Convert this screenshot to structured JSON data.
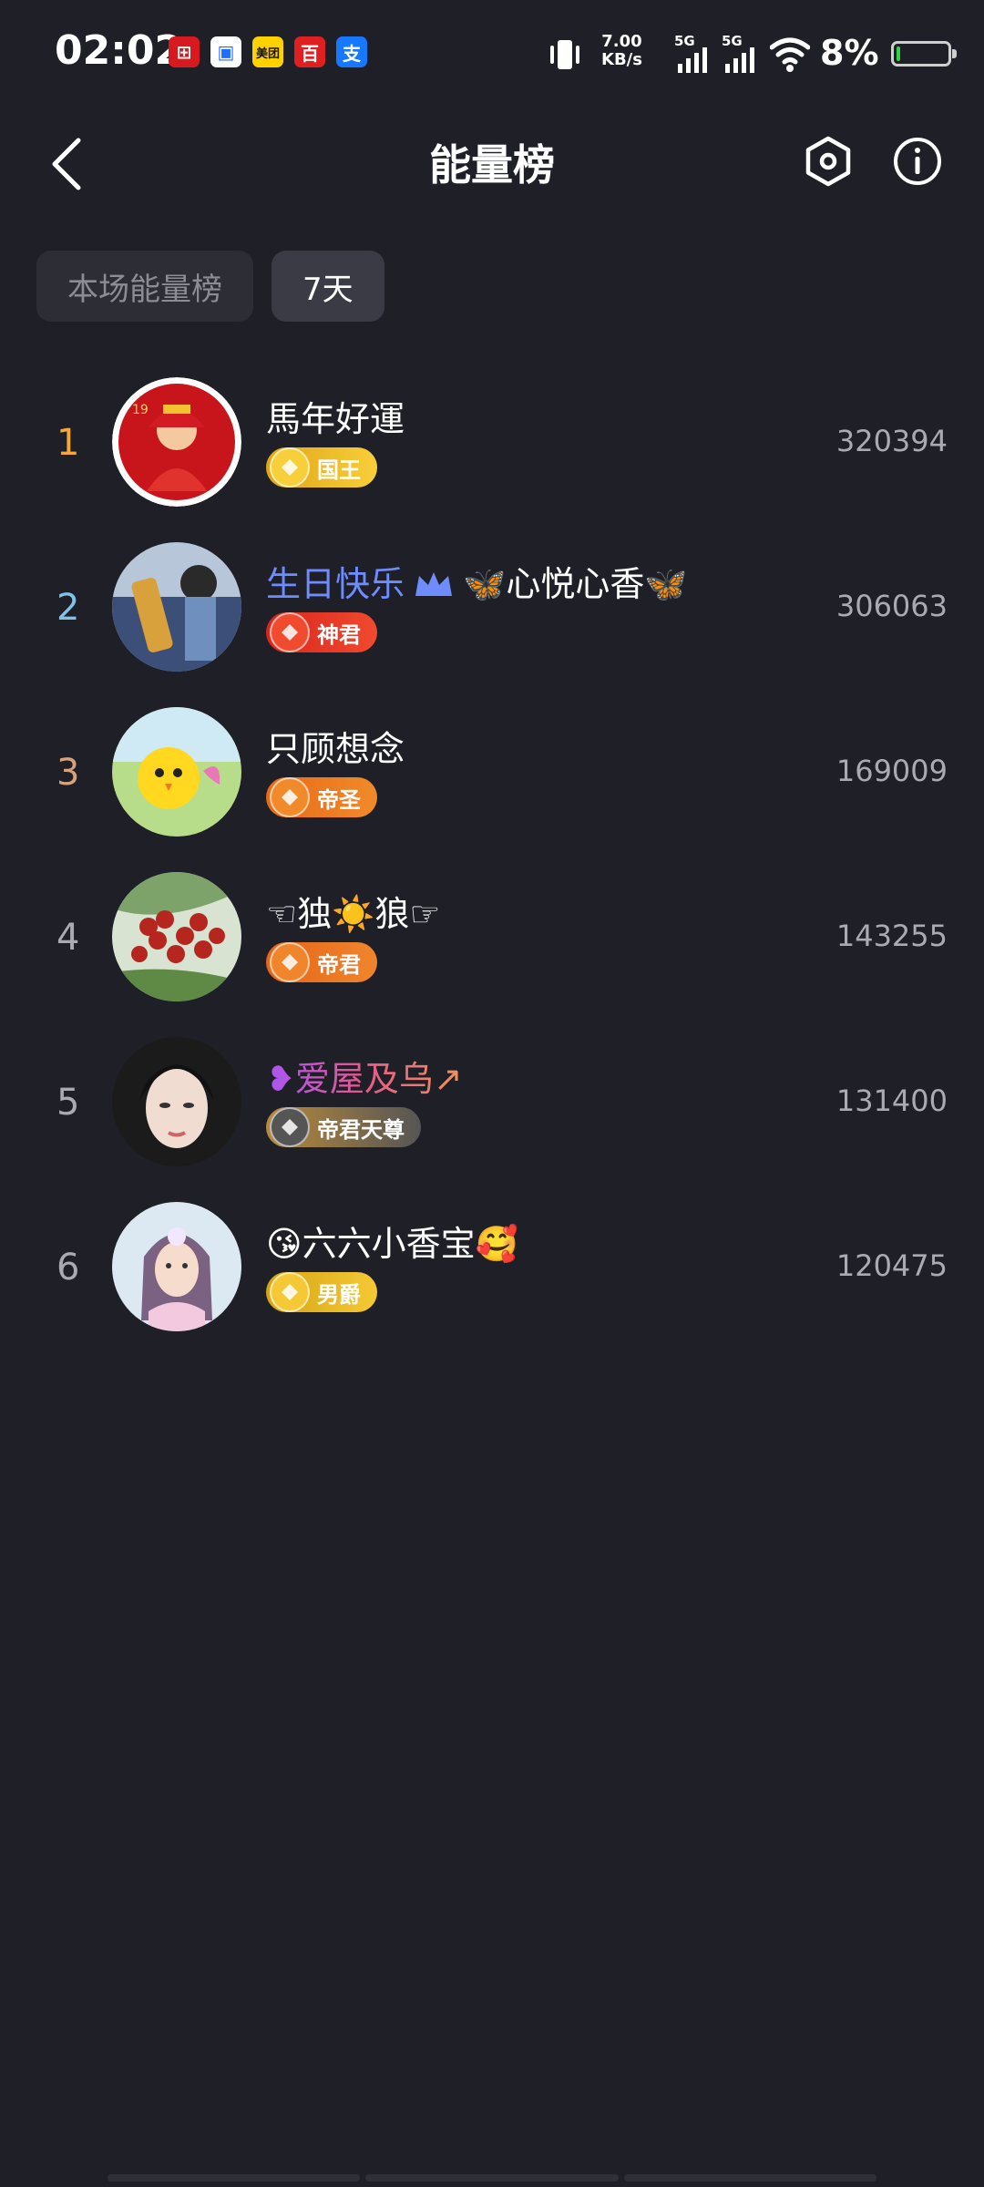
{
  "status_bar": {
    "time": "02:02",
    "app_icons": [
      {
        "name": "bank-app-icon",
        "glyph": "⊞",
        "bg": "#d71920",
        "fg": "#ffffff"
      },
      {
        "name": "blue-app-icon",
        "glyph": "▣",
        "bg": "#ffffff",
        "fg": "#1f6fff"
      },
      {
        "name": "meituan-app-icon",
        "glyph": "美团",
        "bg": "#ffd100",
        "fg": "#111111"
      },
      {
        "name": "baidu-app-icon",
        "glyph": "百",
        "bg": "#e02020",
        "fg": "#ffffff"
      },
      {
        "name": "alipay-app-icon",
        "glyph": "支",
        "bg": "#1677ff",
        "fg": "#ffffff"
      }
    ],
    "net_speed_value": "7.00",
    "net_speed_unit": "KB/s",
    "signal_1_label": "5G",
    "signal_2_label": "5G",
    "battery_percent": "8%"
  },
  "header": {
    "title": "能量榜"
  },
  "tabs": [
    {
      "label": "本场能量榜",
      "active": false
    },
    {
      "label": "7天",
      "active": true
    }
  ],
  "ranking": [
    {
      "rank": "1",
      "rank_color": "#f5a83a",
      "name": "馬年好運",
      "name_color": "#ffffff",
      "badge": "国王",
      "badge_bg": "#e0a516",
      "badge_icon_bg": "#f7cf3a",
      "score": "320394",
      "avatar": "red-figure"
    },
    {
      "rank": "2",
      "rank_color": "#7fc4e8",
      "name_prefix": "生日快乐",
      "name_prefix_color": "#6f8cff",
      "name": "🦋心悦心香🦋",
      "name_color": "#ffffff",
      "crown_icon": "crown-icon",
      "badge": "神君",
      "badge_bg": "#d9261c",
      "badge_icon_bg": "#f04a2f",
      "score": "306063",
      "avatar": "girl-guitar"
    },
    {
      "rank": "3",
      "rank_color": "#d9a27a",
      "name": "只顾想念",
      "name_color": "#ffffff",
      "badge": "帝圣",
      "badge_bg": "#e86a18",
      "badge_icon_bg": "#f08a2a",
      "score": "169009",
      "avatar": "yellow-chick"
    },
    {
      "rank": "4",
      "rank_color": "#a9aab2",
      "name": "☜独☀️狼☞",
      "name_color": "#ffffff",
      "badge": "帝君",
      "badge_bg": "#e5651a",
      "badge_icon_bg": "#f0852c",
      "score": "143255",
      "avatar": "red-berries"
    },
    {
      "rank": "5",
      "rank_color": "#a9aab2",
      "name": "❥爱屋及乌↗",
      "name_color": "#e45a8a",
      "name_gradient": true,
      "badge": "帝君天尊",
      "badge_bg": "#b88a3a",
      "badge_icon_bg": "#555555",
      "score": "131400",
      "avatar": "woman-portrait"
    },
    {
      "rank": "6",
      "rank_color": "#a9aab2",
      "name": "😘六六小香宝🥰",
      "name_color": "#ffffff",
      "badge": "男爵",
      "badge_bg": "#d6a413",
      "badge_icon_bg": "#f5c935",
      "score": "120475",
      "avatar": "fairy-girl"
    }
  ]
}
